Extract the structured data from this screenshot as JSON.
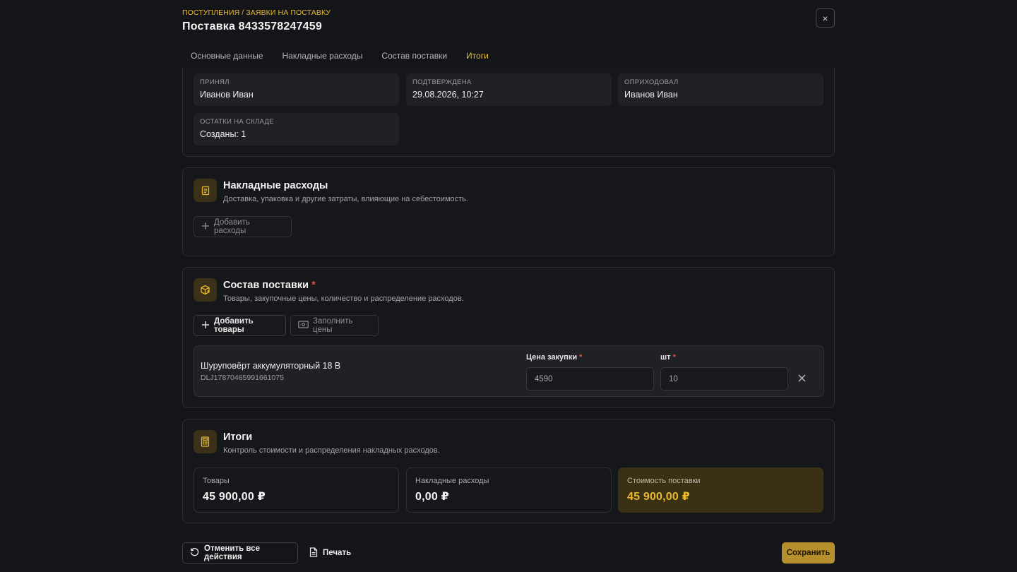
{
  "header": {
    "breadcrumb": "ПОСТУПЛЕНИЯ / ЗАЯВКИ НА ПОСТАВКУ",
    "title": "Поставка 8433578247459",
    "close_glyph": "×"
  },
  "tabs": [
    {
      "label": "Основные данные",
      "active": false
    },
    {
      "label": "Накладные расходы",
      "active": false
    },
    {
      "label": "Состав поставки",
      "active": false
    },
    {
      "label": "Итоги",
      "active": true
    }
  ],
  "info": {
    "accepted_by": {
      "label": "ПРИНЯЛ",
      "value": "Иванов Иван"
    },
    "confirmed": {
      "label": "ПОДТВЕРЖДЕНА",
      "value": "29.08.2026, 10:27"
    },
    "posted_by": {
      "label": "ОПРИХОДОВАЛ",
      "value": "Иванов Иван"
    },
    "stock": {
      "label": "ОСТАТКИ НА СКЛАДЕ",
      "value": "Созданы: 1"
    }
  },
  "overhead": {
    "title": "Накладные расходы",
    "description": "Доставка, упаковка и другие затраты, влияющие на себестоимость.",
    "add_button": "Добавить расходы"
  },
  "composition": {
    "title": "Состав поставки",
    "required_mark": "*",
    "description": "Товары, закупочные цены, количество и распределение расходов.",
    "add_button": "Добавить товары",
    "fill_button": "Заполнить цены",
    "items": [
      {
        "name": "Шуруповёрт аккумуляторный 18 В",
        "sku": "DLJ17870465991661075",
        "price_label": "Цена закупки",
        "price": "4590",
        "qty_label": "шт",
        "qty": "10"
      }
    ]
  },
  "totals": {
    "title": "Итоги",
    "description": "Контроль стоимости и распределения накладных расходов.",
    "goods": {
      "label": "Товары",
      "value": "45 900,00 ₽"
    },
    "overhead": {
      "label": "Накладные расходы",
      "value": "0,00 ₽"
    },
    "total": {
      "label": "Стоимость поставки",
      "value": "45 900,00 ₽"
    }
  },
  "footer": {
    "undo_button": "Отменить все действия",
    "print_button": "Печать",
    "save_button": "Сохранить"
  },
  "colors": {
    "accent": "#e8b92e",
    "background": "#141518",
    "required": "#e0504a",
    "save": "#b58f2c"
  }
}
